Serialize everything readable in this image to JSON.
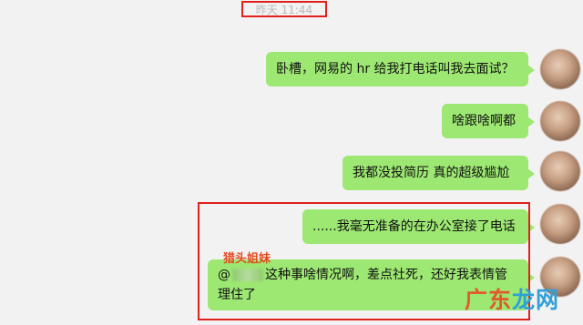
{
  "header": {
    "timestamp": "昨天 11:44"
  },
  "messages": [
    {
      "text": "卧槽，网易的 hr 给我打电话叫我去面试？"
    },
    {
      "text": "啥跟啥啊都"
    },
    {
      "text": "我都没投简历 真的超级尴尬"
    },
    {
      "text": "......我毫无准备的在办公室接了电话"
    },
    {
      "prefix": "@",
      "suffix": "这种事啥情况啊，差点社死，还好我表情管理住了"
    }
  ],
  "annotation": {
    "label": "猎头姐妹"
  },
  "watermark": {
    "part1": "广",
    "part2": "东",
    "part3": "龙",
    "part4": "网"
  },
  "colors": {
    "bubble": "#9de872",
    "highlight": "#e0201c",
    "background": "#f2f2f2"
  }
}
